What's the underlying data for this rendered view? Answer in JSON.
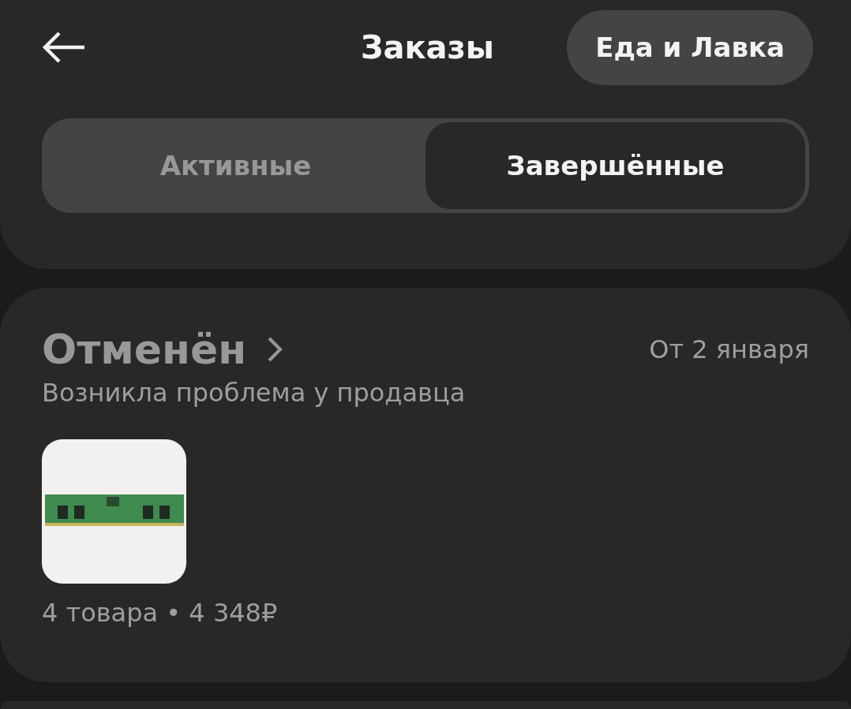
{
  "header": {
    "title": "Заказы",
    "action_button": "Еда и Лавка"
  },
  "tabs": [
    {
      "label": "Активные",
      "selected": false
    },
    {
      "label": "Завершённые",
      "selected": true
    }
  ],
  "orders": [
    {
      "status": "Отменён",
      "date": "От 2 января",
      "reason": "Возникла проблема у продавца",
      "summary": "4 товара • 4 348₽"
    }
  ]
}
